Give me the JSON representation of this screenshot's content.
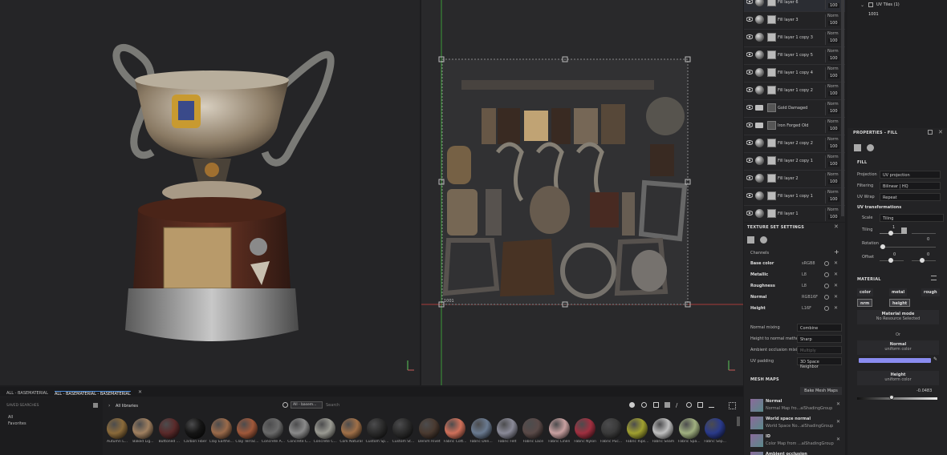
{
  "layers": [
    {
      "name": "Fill layer 6",
      "mode": "Norm",
      "opacity": "100",
      "type": "fill"
    },
    {
      "name": "Fill layer 3",
      "mode": "Norm",
      "opacity": "100",
      "type": "fill"
    },
    {
      "name": "Fill layer 1 copy 3",
      "mode": "Norm",
      "opacity": "100",
      "type": "fill"
    },
    {
      "name": "Fill layer 1 copy 5",
      "mode": "Norm",
      "opacity": "100",
      "type": "fill"
    },
    {
      "name": "Fill layer 1 copy 4",
      "mode": "Norm",
      "opacity": "100",
      "type": "fill"
    },
    {
      "name": "Fill layer 1 copy 2",
      "mode": "Norm",
      "opacity": "100",
      "type": "fill"
    },
    {
      "name": "Gold Damaged",
      "mode": "Norm",
      "opacity": "100",
      "type": "folder"
    },
    {
      "name": "Iron Forged Old",
      "mode": "Norm",
      "opacity": "100",
      "type": "folder"
    },
    {
      "name": "Fill layer 2 copy 2",
      "mode": "Norm",
      "opacity": "100",
      "type": "fill"
    },
    {
      "name": "Fill layer 2 copy 1",
      "mode": "Norm",
      "opacity": "100",
      "type": "fill"
    },
    {
      "name": "Fill layer 2",
      "mode": "Norm",
      "opacity": "100",
      "type": "fill"
    },
    {
      "name": "Fill layer 1 copy 1",
      "mode": "Norm",
      "opacity": "100",
      "type": "fill"
    },
    {
      "name": "Fill layer 1",
      "mode": "Norm",
      "opacity": "100",
      "type": "fill"
    }
  ],
  "texture_set": {
    "title": "TEXTURE SET SETTINGS",
    "channels_label": "Channels",
    "channels": [
      {
        "name": "Base color",
        "format": "sRGB8"
      },
      {
        "name": "Metallic",
        "format": "L8"
      },
      {
        "name": "Roughness",
        "format": "L8"
      },
      {
        "name": "Normal",
        "format": "RGB16F"
      },
      {
        "name": "Height",
        "format": "L16F"
      }
    ],
    "settings": [
      {
        "label": "Normal mixing",
        "value": "Combine"
      },
      {
        "label": "Height to normal method",
        "value": "Sharp"
      },
      {
        "label": "Ambient occlusion mixing",
        "value": "Multiply"
      },
      {
        "label": "UV padding",
        "value": "3D Space Neighbor"
      }
    ],
    "mesh_maps_title": "MESH MAPS",
    "bake_button": "Bake Mesh Maps",
    "mesh_maps": [
      {
        "title": "Normal",
        "sub": "Normal Map fro...alShadingGroup"
      },
      {
        "title": "World space normal",
        "sub": "World Space No...alShadingGroup"
      },
      {
        "title": "ID",
        "sub": "Color Map from ...alShadingGroup"
      },
      {
        "title": "Ambient occlusion",
        "sub": ""
      }
    ]
  },
  "uv_tiles": {
    "title": "UV Tiles (1)",
    "tile": "1001"
  },
  "properties": {
    "title": "PROPERTIES - FILL",
    "fill_label": "FILL",
    "projection": {
      "label": "Projection",
      "value": "UV projection"
    },
    "filtering": {
      "label": "Filtering",
      "value": "Bilinear | HQ"
    },
    "uv_wrap": {
      "label": "UV Wrap",
      "value": "Repeat"
    },
    "uv_transformations": "UV transformations",
    "scale": {
      "label": "Scale",
      "value": "Tiling"
    },
    "tiling": {
      "label": "Tiling",
      "value": "1",
      "min": "0"
    },
    "rotation": {
      "label": "Rotation",
      "value": "0"
    },
    "offset": {
      "label": "Offset",
      "x": "0",
      "y": "0"
    },
    "material_title": "MATERIAL",
    "chips": [
      "color",
      "metal",
      "rough",
      "nrm",
      "height"
    ],
    "material_mode_title": "Material mode",
    "material_mode_value": "No Resource Selected",
    "or": "Or",
    "normal_title": "Normal",
    "normal_value": "uniform color",
    "normal_color": "#8a8cf0",
    "height_title": "Height",
    "height_value": "uniform color",
    "height_number": "-0.0483"
  },
  "viewport2d": {
    "uv_label": "1001"
  },
  "shelf": {
    "tabs": [
      "ALL - BASEMATERIAL",
      "ALL - BASEMATERIAL - BASEMATERIAL"
    ],
    "saved_searches": "SAVED SEARCHES",
    "tree": [
      "All",
      "Favorites"
    ],
    "library": "All libraries",
    "filter_chip": "All - basem...",
    "search_placeholder": "Search",
    "materials": [
      {
        "name": "Autumn L...",
        "color": "#8a6a3a"
      },
      {
        "name": "Baked Lig...",
        "color": "#a08060"
      },
      {
        "name": "Buttoned ...",
        "color": "#5a2a2a"
      },
      {
        "name": "Carbon Fiber",
        "color": "#151515"
      },
      {
        "name": "Clay Earthe...",
        "color": "#9a6a4a"
      },
      {
        "name": "Clay Terrac...",
        "color": "#a0583a"
      },
      {
        "name": "Concrete A...",
        "color": "#6a6a6a"
      },
      {
        "name": "Concrete C...",
        "color": "#8a8a8a"
      },
      {
        "name": "Concrete C...",
        "color": "#9a9a92"
      },
      {
        "name": "Cork Natural",
        "color": "#a07048"
      },
      {
        "name": "Custom Sp...",
        "color": "#2a2a2a"
      },
      {
        "name": "Custom St...",
        "color": "#2a2a2a"
      },
      {
        "name": "Denim Rivet",
        "color": "#4a3a30"
      },
      {
        "name": "Fabric Cott...",
        "color": "#d0705a"
      },
      {
        "name": "Fabric Den...",
        "color": "#6a7a90"
      },
      {
        "name": "Fabric Felt",
        "color": "#8a8a98"
      },
      {
        "name": "Fabric Lace",
        "color": "#5a4a48"
      },
      {
        "name": "Fabric Linen",
        "color": "#c8a0a0"
      },
      {
        "name": "Fabric Nylon",
        "color": "#a03040"
      },
      {
        "name": "Fabric Puc...",
        "color": "#3a3a3a"
      },
      {
        "name": "Fabric Rips...",
        "color": "#a0a030"
      },
      {
        "name": "Fabric Seam",
        "color": "#c0c0c0"
      },
      {
        "name": "Fabric Spa...",
        "color": "#a0b080"
      },
      {
        "name": "Fabric Sep...",
        "color": "#2a3a8a"
      }
    ]
  }
}
